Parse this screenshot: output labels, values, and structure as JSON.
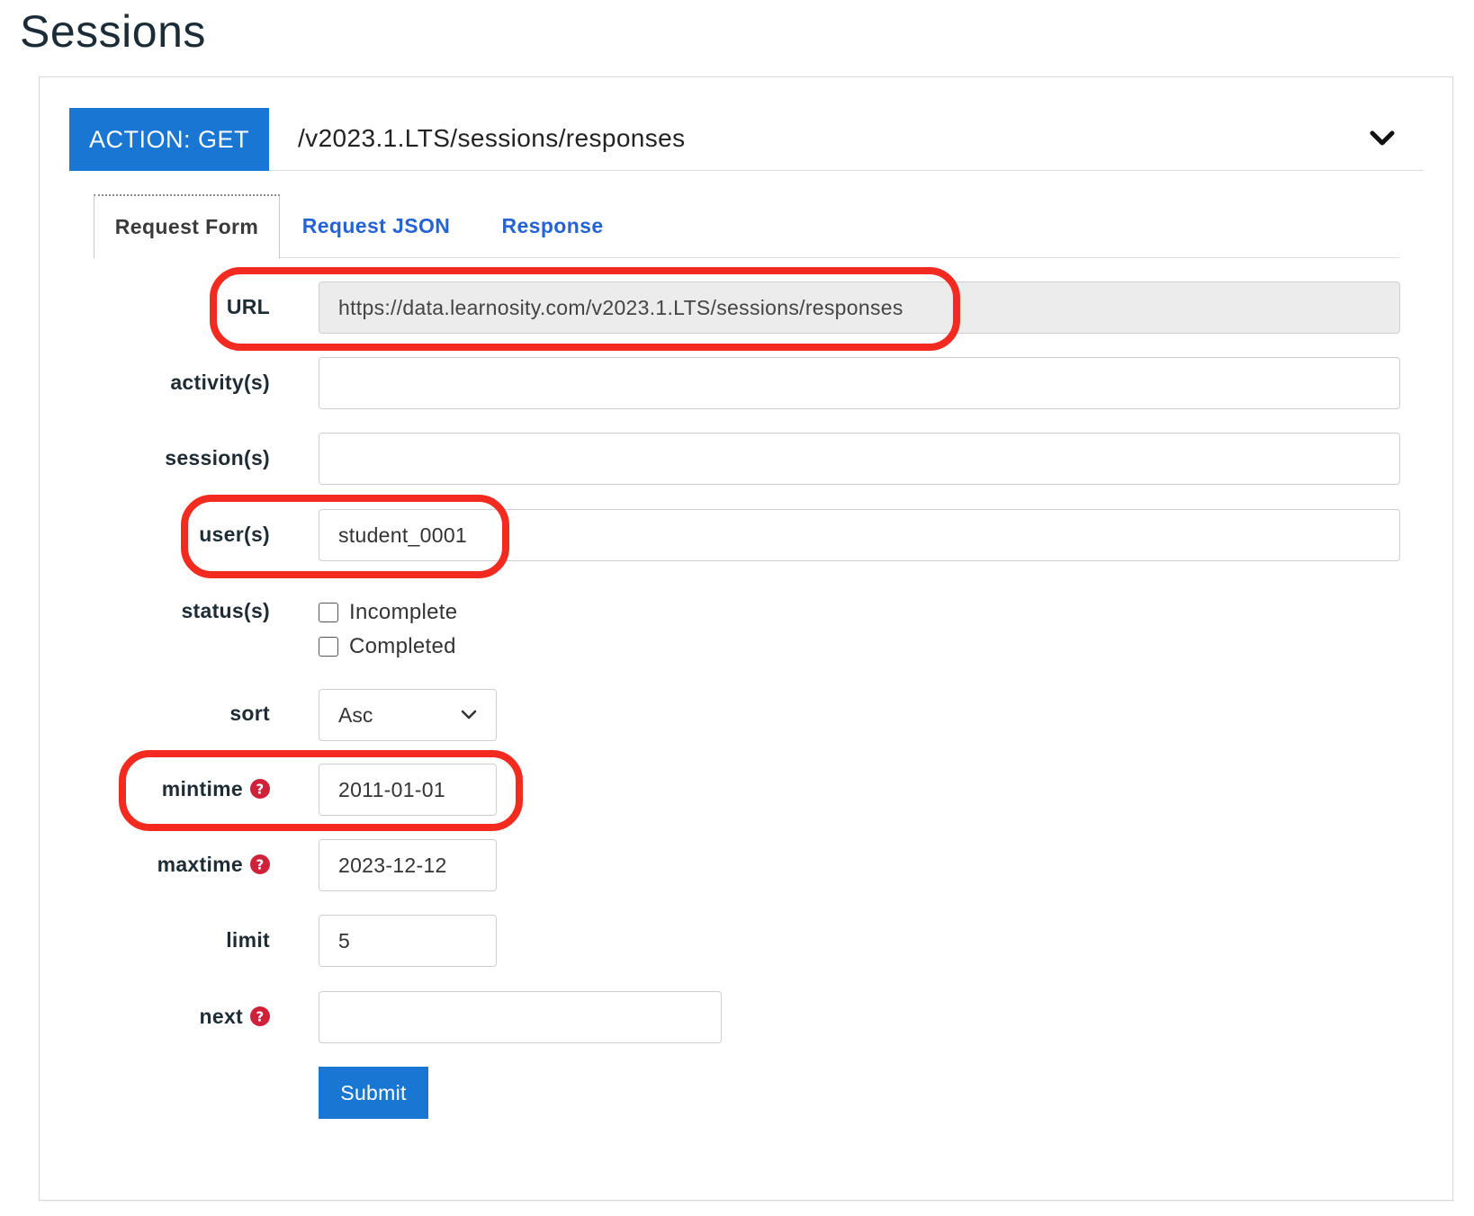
{
  "page": {
    "title": "Sessions"
  },
  "action": {
    "badge": "ACTION: GET",
    "path": "/v2023.1.LTS/sessions/responses"
  },
  "tabs": [
    {
      "label": "Request Form",
      "active": true
    },
    {
      "label": "Request JSON",
      "active": false
    },
    {
      "label": "Response",
      "active": false
    }
  ],
  "form": {
    "url": {
      "label": "URL",
      "value": "https://data.learnosity.com/v2023.1.LTS/sessions/responses"
    },
    "activities": {
      "label": "activity(s)",
      "value": ""
    },
    "sessions": {
      "label": "session(s)",
      "value": ""
    },
    "users": {
      "label": "user(s)",
      "value": "student_0001"
    },
    "statuses": {
      "label": "status(s)",
      "options": [
        "Incomplete",
        "Completed"
      ]
    },
    "sort": {
      "label": "sort",
      "value": "Asc"
    },
    "mintime": {
      "label": "mintime",
      "value": "2011-01-01"
    },
    "maxtime": {
      "label": "maxtime",
      "value": "2023-12-12"
    },
    "limit": {
      "label": "limit",
      "value": "5"
    },
    "next": {
      "label": "next",
      "value": ""
    },
    "submit_label": "Submit"
  },
  "colors": {
    "accent": "#1976d2",
    "link": "#2463d6",
    "help": "#d0213a",
    "highlight": "#f22a1f"
  },
  "icons": {
    "collapse": "chevron-down-icon",
    "help": "question-circle-icon"
  }
}
